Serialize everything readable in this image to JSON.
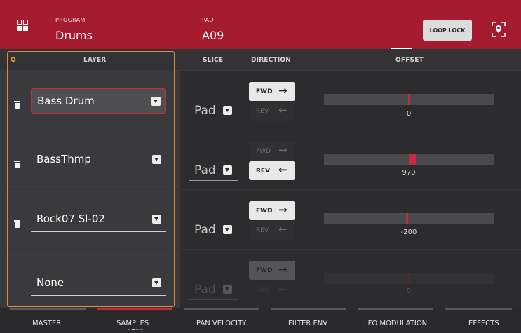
{
  "header": {
    "program_label": "PROGRAM",
    "program_value": "Drums",
    "pad_label": "PAD",
    "pad_value": "A09",
    "loop_lock_label": "LOOP LOCK",
    "icons": [
      "menu-grid-icon",
      "locate-icon"
    ]
  },
  "columns": {
    "q": "Q",
    "layer": "LAYER",
    "slice": "SLICE",
    "direction": "DIRECTION",
    "offset": "OFFSET"
  },
  "layers": [
    {
      "sample": "Bass Drum",
      "slice": "Pad",
      "fwd": "FWD",
      "rev": "REV",
      "direction": "FWD",
      "offset": "0",
      "offset_fraction": 0.5,
      "selected": true,
      "has_trash": true,
      "dimmed": false
    },
    {
      "sample": "BassThmp",
      "slice": "Pad",
      "fwd": "FWD",
      "rev": "REV",
      "direction": "REV",
      "offset": "970",
      "offset_fraction": 0.52,
      "selected": false,
      "has_trash": true,
      "dimmed": false
    },
    {
      "sample": "Rock07 Sl-02",
      "slice": "Pad",
      "fwd": "FWD",
      "rev": "REV",
      "direction": "FWD",
      "offset": "-200",
      "offset_fraction": 0.49,
      "selected": false,
      "has_trash": true,
      "dimmed": false
    },
    {
      "sample": "None",
      "slice": "Pad",
      "fwd": "FWD",
      "rev": "REV",
      "direction": "FWD",
      "offset": "0",
      "offset_fraction": 0.5,
      "selected": false,
      "has_trash": false,
      "dimmed": true
    }
  ],
  "tabs": [
    {
      "label": "MASTER",
      "active": false
    },
    {
      "label": "SAMPLES",
      "active": true
    },
    {
      "label": "PAN VELOCITY",
      "active": false
    },
    {
      "label": "FILTER ENV",
      "active": false
    },
    {
      "label": "LFO MODULATION",
      "active": false
    },
    {
      "label": "EFFECTS",
      "active": false
    }
  ],
  "colors": {
    "header_bg": "#a51c30",
    "accent_red": "#c52b42",
    "q_orange": "#d88b38"
  }
}
